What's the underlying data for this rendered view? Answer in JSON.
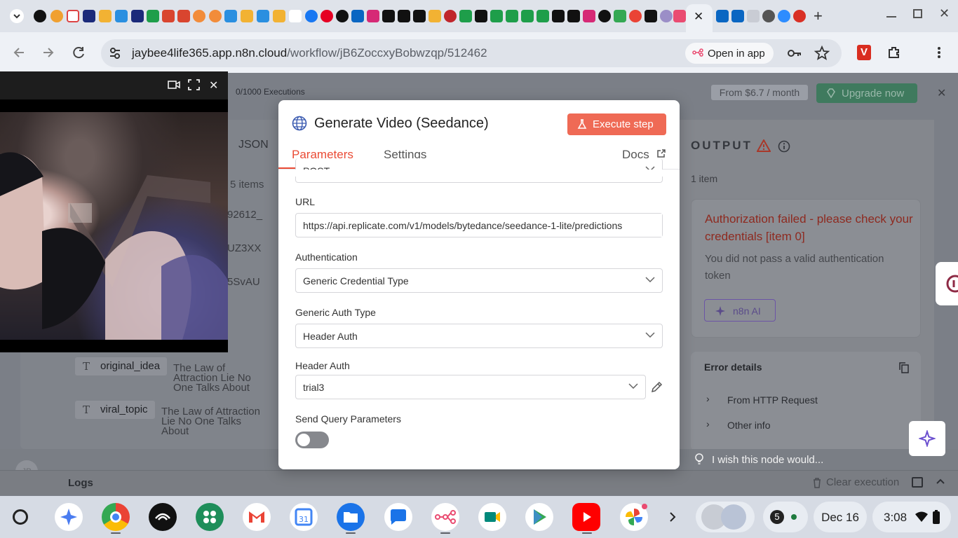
{
  "browser": {
    "url_host": "jaybee4life365.app.n8n.cloud",
    "url_path": "/workflow/jB6ZoccxyBobwzqp/512462",
    "open_in_app": "Open in app",
    "tab_close": "✕",
    "new_tab": "+"
  },
  "n8n": {
    "executions": "0/1000 Executions",
    "pricing": "From $6.7 / month",
    "upgrade": "Upgrade now",
    "logs": "Logs",
    "clear_execution": "Clear execution",
    "avatar": "JB",
    "wish": "I wish this node would..."
  },
  "input_panel": {
    "json_tab": "JSON",
    "items": "5 items",
    "frag1": "92612_",
    "frag2": "UZ3XX",
    "frag3": "5SvAU",
    "rows": [
      {
        "key": "original_idea",
        "value": "The Law of Attraction Lie No One Talks About"
      },
      {
        "key": "viral_topic",
        "value": "The Law of Attraction Lie No One Talks About"
      }
    ]
  },
  "dialog": {
    "title": "Generate Video (Seedance)",
    "execute": "Execute step",
    "tabs": {
      "parameters": "Parameters",
      "settings": "Settings",
      "docs": "Docs"
    },
    "method_value": "POST",
    "url_label": "URL",
    "url_value": "https://api.replicate.com/v1/models/bytedance/seedance-1-lite/predictions",
    "auth_label": "Authentication",
    "auth_value": "Generic Credential Type",
    "gen_auth_label": "Generic Auth Type",
    "gen_auth_value": "Header Auth",
    "header_auth_label": "Header Auth",
    "header_auth_value": "trial3",
    "send_query_label": "Send Query Parameters",
    "send_query_on": false
  },
  "output": {
    "header": "OUTPUT",
    "count": "1 item",
    "error_title": "Authorization failed - please check your credentials [item 0]",
    "error_desc": "You did not pass a valid authentication token",
    "n8n_ai": "n8n AI",
    "details_title": "Error details",
    "detail_rows": [
      "From HTTP Request",
      "Other info"
    ]
  },
  "shelf": {
    "notif_count": "5",
    "date": "Dec 16",
    "time": "3:08"
  },
  "colors": {
    "accent": "#ea4b35",
    "error": "#c0392b",
    "upgrade": "#3f7a5e"
  }
}
